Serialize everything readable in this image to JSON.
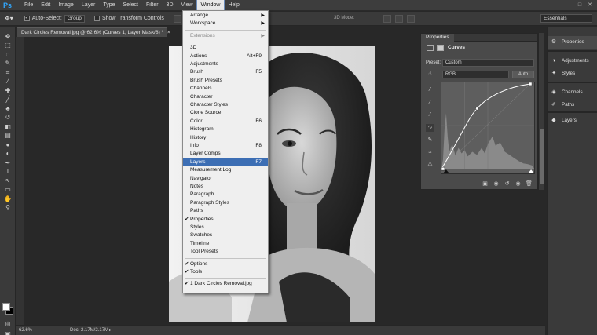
{
  "app": {
    "logo": "Ps"
  },
  "menubar": {
    "items": [
      "File",
      "Edit",
      "Image",
      "Layer",
      "Type",
      "Select",
      "Filter",
      "3D",
      "View",
      "Window",
      "Help"
    ],
    "active_index": 9
  },
  "window_controls": {
    "minimize": "–",
    "maximize": "□",
    "close": "✕"
  },
  "options_bar": {
    "auto_select_label": "Auto-Select:",
    "auto_select_value": "Group",
    "show_transform_label": "Show Transform Controls",
    "mode_label": "3D Mode:",
    "workspace": "Essentials"
  },
  "document": {
    "tab_title": "Dark Circles Removal.jpg @ 62.6% (Curves 1, Layer Mask/8) *",
    "tab_close": "×"
  },
  "status": {
    "zoom": "62.6%",
    "doc_size": "Doc: 2.17M/2.17M",
    "arrow": "▸"
  },
  "window_menu": {
    "items": [
      {
        "label": "Arrange",
        "submenu": true
      },
      {
        "label": "Workspace",
        "submenu": true
      },
      {
        "sep": true
      },
      {
        "label": "Extensions",
        "submenu": true,
        "disabled": true
      },
      {
        "sep": true
      },
      {
        "label": "3D"
      },
      {
        "label": "Actions",
        "shortcut": "Alt+F9"
      },
      {
        "label": "Adjustments"
      },
      {
        "label": "Brush",
        "shortcut": "F5"
      },
      {
        "label": "Brush Presets"
      },
      {
        "label": "Channels"
      },
      {
        "label": "Character"
      },
      {
        "label": "Character Styles"
      },
      {
        "label": "Clone Source"
      },
      {
        "label": "Color",
        "shortcut": "F6"
      },
      {
        "label": "Histogram"
      },
      {
        "label": "History"
      },
      {
        "label": "Info",
        "shortcut": "F8"
      },
      {
        "label": "Layer Comps"
      },
      {
        "label": "Layers",
        "shortcut": "F7",
        "selected": true
      },
      {
        "label": "Measurement Log"
      },
      {
        "label": "Navigator"
      },
      {
        "label": "Notes"
      },
      {
        "label": "Paragraph"
      },
      {
        "label": "Paragraph Styles"
      },
      {
        "label": "Paths"
      },
      {
        "label": "Properties",
        "checked": true
      },
      {
        "label": "Styles"
      },
      {
        "label": "Swatches"
      },
      {
        "label": "Timeline"
      },
      {
        "label": "Tool Presets"
      },
      {
        "sep": true
      },
      {
        "label": "Options",
        "checked": true
      },
      {
        "label": "Tools",
        "checked": true
      },
      {
        "sep": true
      },
      {
        "label": "1 Dark Circles Removal.jpg",
        "checked": true
      }
    ]
  },
  "properties": {
    "tab": "Properties",
    "title": "Curves",
    "preset_label": "Preset:",
    "preset_value": "Custom",
    "channel_value": "RGB",
    "auto_label": "Auto"
  },
  "dock": {
    "items": [
      "Properties",
      "Adjustments",
      "Styles",
      "Channels",
      "Paths",
      "Layers"
    ],
    "active_index": 0
  }
}
